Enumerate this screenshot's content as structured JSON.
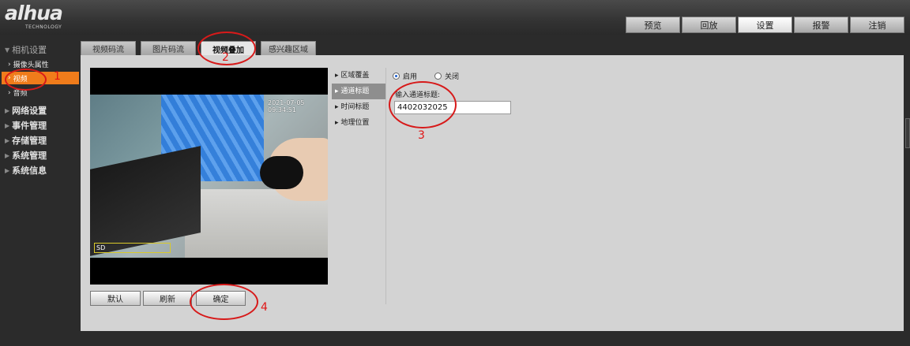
{
  "brand": {
    "logo": "alhua",
    "tagline": "TECHNOLOGY"
  },
  "top_nav": [
    {
      "label": "预览"
    },
    {
      "label": "回放"
    },
    {
      "label": "设置",
      "active": true
    },
    {
      "label": "报警"
    },
    {
      "label": "注销"
    }
  ],
  "sidebar": {
    "groups": [
      {
        "label": "相机设置"
      },
      {
        "label": "网络设置"
      },
      {
        "label": "事件管理"
      },
      {
        "label": "存储管理"
      },
      {
        "label": "系统管理"
      },
      {
        "label": "系统信息"
      }
    ],
    "sub_items": [
      {
        "label": "摄像头属性"
      },
      {
        "label": "视频",
        "active": true
      },
      {
        "label": "音频"
      }
    ]
  },
  "sub_tabs": [
    {
      "label": "视频码流"
    },
    {
      "label": "图片码流"
    },
    {
      "label": "视频叠加",
      "active": true
    },
    {
      "label": "感兴趣区域"
    }
  ],
  "video": {
    "osd_time": "2021-07-05 09:34:51",
    "osd_channel": "SD"
  },
  "buttons": {
    "default": "默认",
    "refresh": "刷新",
    "confirm": "确定"
  },
  "overlay_menu": [
    {
      "label": "区域覆盖"
    },
    {
      "label": "通道标题",
      "active": true
    },
    {
      "label": "时间标题"
    },
    {
      "label": "地理位置"
    }
  ],
  "channel_title": {
    "enable_label": "启用",
    "disable_label": "关闭",
    "enabled": true,
    "input_label": "输入通道标题:",
    "input_value": "4402032025"
  },
  "annotations": [
    "1",
    "2",
    "3",
    "4"
  ],
  "colors": {
    "accent": "#f07c1b",
    "annotation": "#e01515"
  }
}
